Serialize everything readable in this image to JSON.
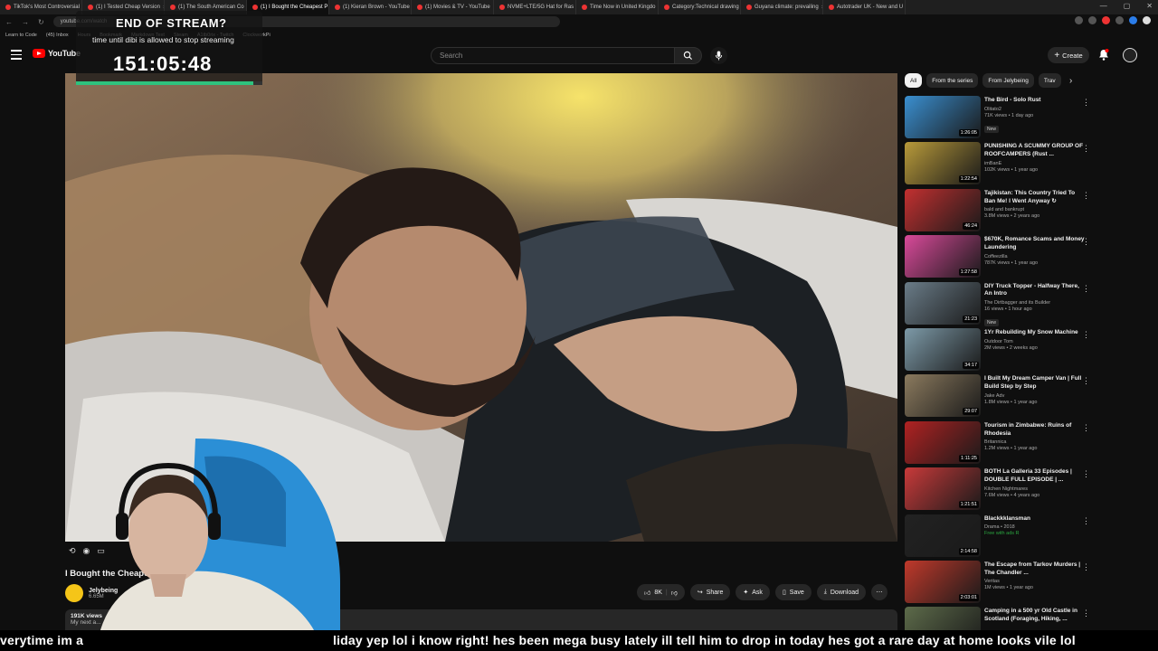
{
  "browser": {
    "tabs": [
      {
        "label": "TikTok's Most Controversial"
      },
      {
        "label": "(1) I Tested Cheap Version"
      },
      {
        "label": "(1) The South American Co"
      },
      {
        "label": "(1) I Bought the Cheapest P",
        "active": true
      },
      {
        "label": "(1) Kieran Brown - YouTube"
      },
      {
        "label": "(1) Movies & TV - YouTube"
      },
      {
        "label": "NVME+LTE/5G Hat for Ras"
      },
      {
        "label": "Time Now in United Kingdo"
      },
      {
        "label": "Category:Technical drawing"
      },
      {
        "label": "Guyana climate: prevailing"
      },
      {
        "label": "Autotrader UK - New and U"
      }
    ],
    "url": "youtube.com/watch",
    "bookmarks": [
      "Learn to Code",
      "(45) Inbox",
      "Hours",
      "Bookmark",
      "Markdown Text",
      "Steam",
      "A1tb0rix - Twitch",
      "ClockworkPi"
    ]
  },
  "overlay": {
    "title": "END OF STREAM?",
    "subtitle": "time until dibi is allowed to stop streaming",
    "timer": "151:05:48",
    "progress": 0.95,
    "progress_color": "#2ec27e"
  },
  "header": {
    "logo": "YouTube",
    "search_placeholder": "Search",
    "create_label": "Create"
  },
  "video": {
    "title": "I Bought the Cheapest ... (Documentary)",
    "channel": "Jelybeing",
    "subs": "6.65M",
    "views": "191K views",
    "desc_more": "My next a...",
    "likes": "8K",
    "share_label": "Share",
    "ask_label": "Ask",
    "save_label": "Save",
    "download_label": "Download"
  },
  "chips": [
    "All",
    "From the series",
    "From Jelybeing",
    "Trav"
  ],
  "recommendations": [
    {
      "title": "The Bird - Solo Rust",
      "channel": "Olitato2",
      "meta": "71K views • 1 day ago",
      "badge": "New",
      "duration": "1:26:05",
      "color": "#3a8fd0"
    },
    {
      "title": "PUNISHING A SCUMMY GROUP OF ROOFCAMPERS (Rust ...",
      "channel": "imBanE",
      "meta": "102K views • 1 year ago",
      "badge": "",
      "duration": "1:22:54",
      "color": "#b89a3a"
    },
    {
      "title": "Tajikistan: This Country Tried To Ban Me! I Went Anyway ↻",
      "channel": "bald and bankrupt",
      "meta": "3.8M views • 2 years ago",
      "badge": "",
      "duration": "46:24",
      "color": "#c23030"
    },
    {
      "title": "$670K, Romance Scams and Money Laundering",
      "channel": "Coffeezilla",
      "meta": "787K views • 1 year ago",
      "badge": "",
      "duration": "1:27:58",
      "color": "#d94a9a"
    },
    {
      "title": "DIY Truck Topper - Halfway There, An Intro",
      "channel": "The Dirtbagger and its Builder",
      "meta": "16 views • 1 hour ago",
      "badge": "New",
      "duration": "21:23",
      "color": "#6a7c88"
    },
    {
      "title": "1Yr Rebuilding My Snow Machine",
      "channel": "Outdoor Tom",
      "meta": "2M views • 2 weeks ago",
      "badge": "",
      "duration": "34:17",
      "color": "#7d9aa8"
    },
    {
      "title": "I Built My Dream Camper Van | Full Build Step by Step",
      "channel": "Jake Adv",
      "meta": "1.8M views • 1 year ago",
      "badge": "",
      "duration": "29:07",
      "color": "#8b7a5e"
    },
    {
      "title": "Tourism in Zimbabwe: Ruins of Rhodesia",
      "channel": "Britannica",
      "meta": "1.2M views • 1 year ago",
      "badge": "",
      "duration": "1:11:25",
      "color": "#b02222"
    },
    {
      "title": "BOTH La Galleria 33 Episodes | DOUBLE FULL EPISODE | ...",
      "channel": "Kitchen Nightmares",
      "meta": "7.6M views • 4 years ago",
      "badge": "",
      "duration": "1:21:51",
      "color": "#c83a3a"
    },
    {
      "title": "Blackkklansman",
      "channel": "Drama • 2018",
      "meta": "Free with ads  R",
      "badge": "",
      "duration": "2:14:58",
      "color": "#222222",
      "free": true
    },
    {
      "title": "The Escape from Tarkov Murders | The Chandler ...",
      "channel": "Veritas",
      "meta": "1M views • 1 year ago",
      "badge": "",
      "duration": "2:03:01",
      "color": "#c0392b"
    },
    {
      "title": "Camping in a 500 yr Old Castle in Scotland (Foraging, Hiking, ...",
      "channel": "",
      "meta": "",
      "badge": "",
      "duration": "",
      "color": "#5d6b4a"
    }
  ],
  "captions": {
    "left": "verytime im a",
    "right": "liday yep lol i know right! hes been mega busy lately ill tell him to drop in today hes got a rare day at home looks vile lol"
  }
}
